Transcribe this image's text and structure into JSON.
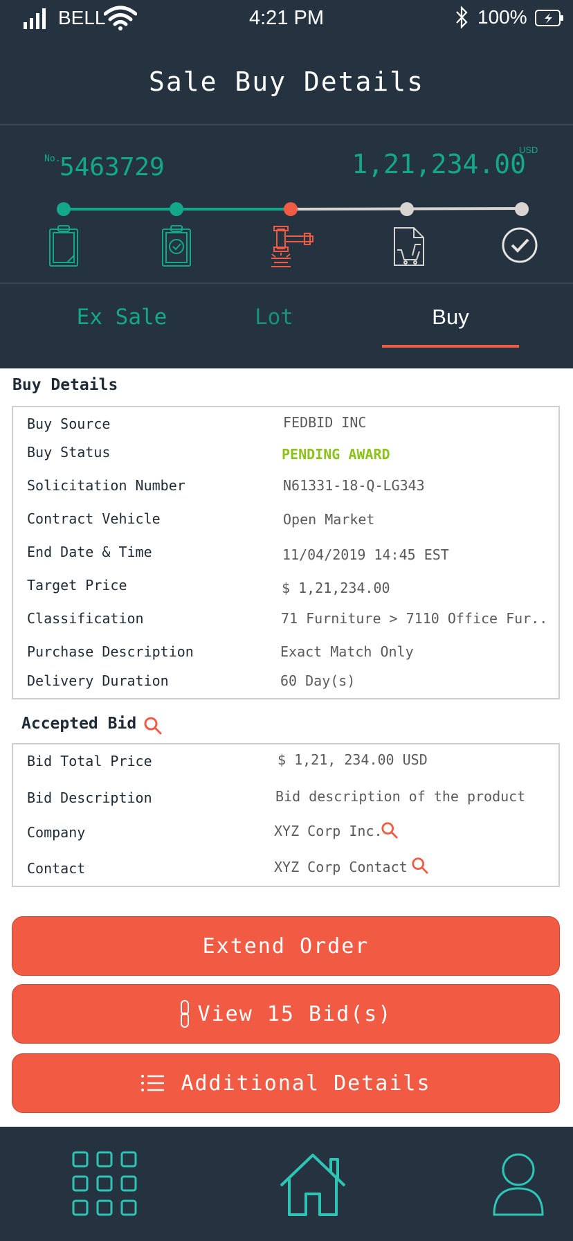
{
  "status_bar": {
    "carrier": "BELL",
    "time": "4:21 PM",
    "battery_percent": "100%"
  },
  "header": {
    "title": "Sale Buy Details"
  },
  "summary": {
    "number_prefix": "No.",
    "number": "5463729",
    "currency": "USD",
    "amount": "1,21,234.00",
    "progress": {
      "current_step": 3,
      "total_steps": 5,
      "steps": [
        {
          "icon": "clipboard-icon",
          "state": "done"
        },
        {
          "icon": "clipboard-check-icon",
          "state": "done"
        },
        {
          "icon": "gavel-icon",
          "state": "current"
        },
        {
          "icon": "cart-document-icon",
          "state": "pending"
        },
        {
          "icon": "check-circle-icon",
          "state": "pending"
        }
      ]
    },
    "colors": {
      "done": "#14a88b",
      "current": "#f15b44",
      "pending": "#d8d4d0"
    }
  },
  "tabs": [
    {
      "label": "Ex Sale",
      "active": false
    },
    {
      "label": "Lot",
      "active": false
    },
    {
      "label": "Buy",
      "active": true
    }
  ],
  "buy_details": {
    "title": "Buy Details",
    "rows": [
      {
        "label": "Buy Source",
        "value": "FEDBID INC"
      },
      {
        "label": "Buy Status",
        "value": "PENDING AWARD"
      },
      {
        "label": "Solicitation Number",
        "value": "N61331-18-Q-LG343"
      },
      {
        "label": "Contract Vehicle",
        "value": "Open Market"
      },
      {
        "label": "End Date & Time",
        "value": "11/04/2019 14:45 EST"
      },
      {
        "label": "Target Price",
        "value": "$ 1,21,234.00"
      },
      {
        "label": "Classification",
        "value": "71 Furniture > 7110 Office Fur.."
      },
      {
        "label": "Purchase Description",
        "value": "Exact Match Only"
      },
      {
        "label": "Delivery Duration",
        "value": "60 Day(s)"
      }
    ]
  },
  "accepted_bid": {
    "title": "Accepted Bid",
    "rows": [
      {
        "label": "Bid Total Price",
        "value": "$ 1,21, 234.00 USD"
      },
      {
        "label": "Bid Description",
        "value": "Bid description of the product"
      },
      {
        "label": "Company",
        "value": "XYZ Corp Inc."
      },
      {
        "label": "Contact",
        "value": "XYZ Corp Contact"
      }
    ]
  },
  "actions": {
    "extend": "Extend Order",
    "view_bids": "View 15 Bid(s)",
    "additional": "Additional Details"
  },
  "bottom_nav": {
    "items": [
      "grid-icon",
      "home-icon",
      "profile-icon"
    ]
  },
  "theme": {
    "primary_dark": "#253340",
    "accent_teal": "#14a88b",
    "accent_orange": "#f15b44",
    "status_green": "#8cc21c"
  }
}
